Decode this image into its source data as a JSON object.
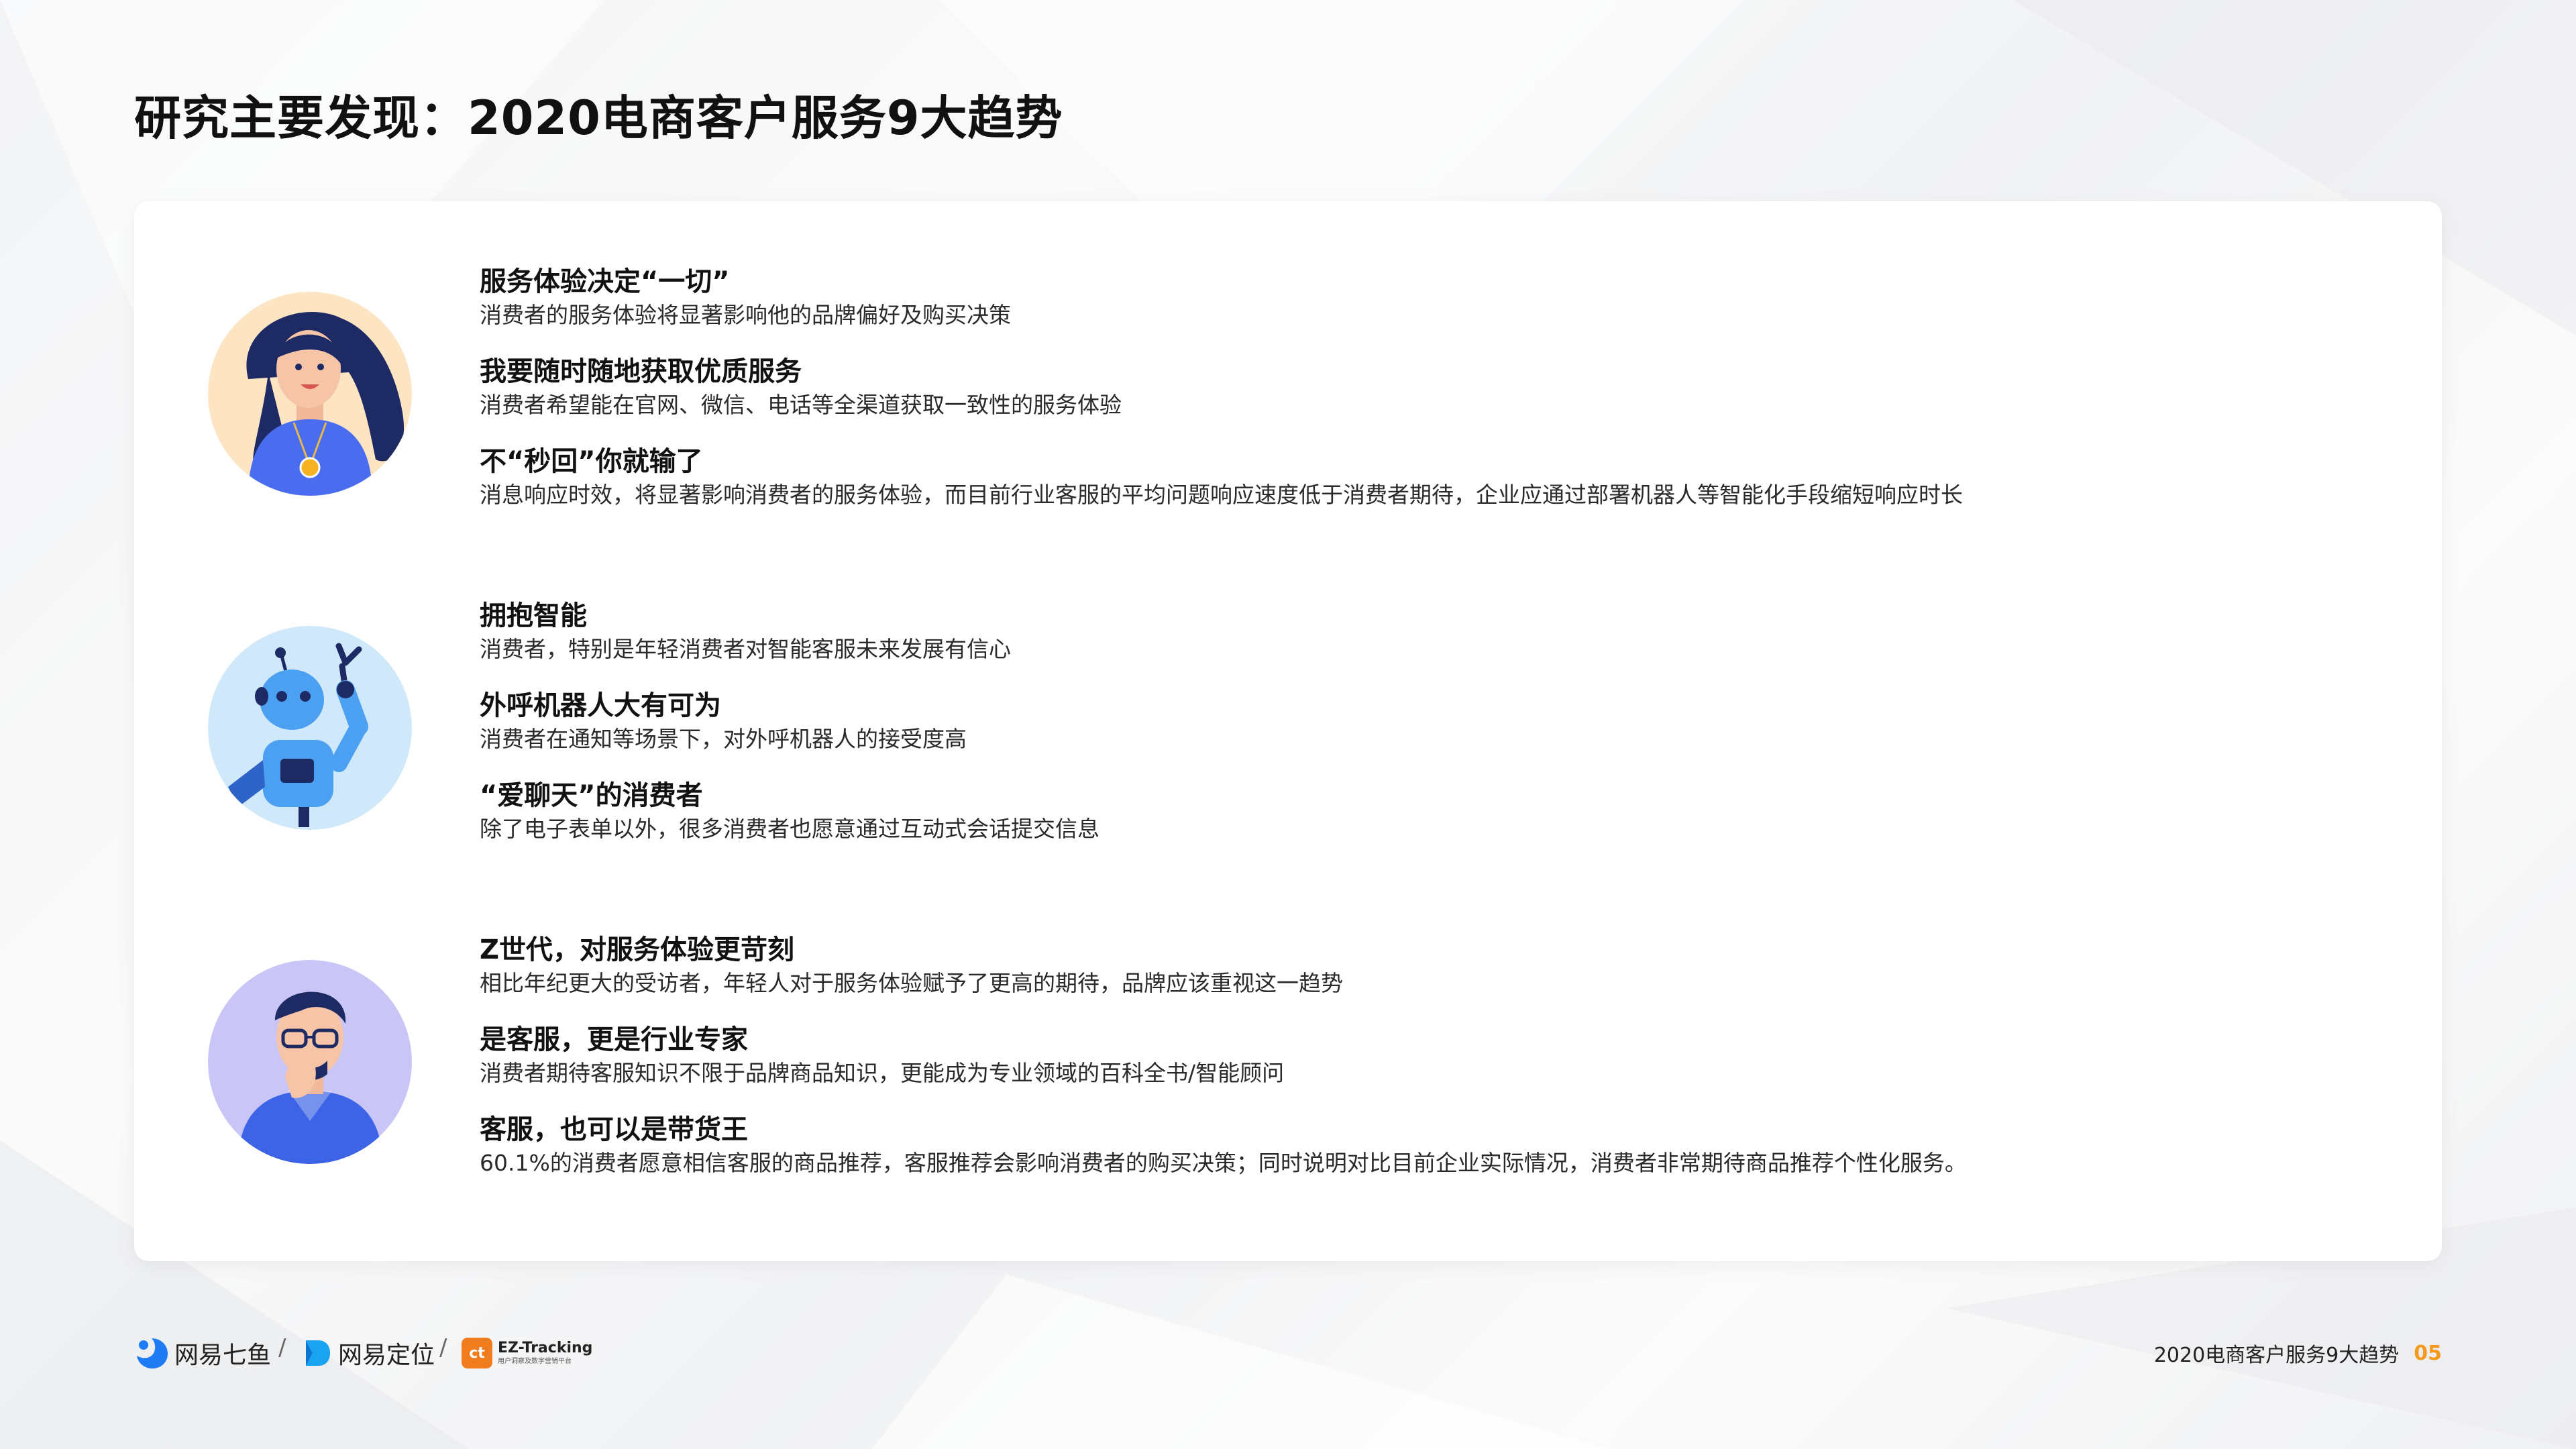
{
  "title": "研究主要发现：2020电商客户服务9大趋势",
  "groups": [
    {
      "avatar": "woman-avatar",
      "items": [
        {
          "title": "服务体验决定“一切”",
          "desc": "消费者的服务体验将显著影响他的品牌偏好及购买决策"
        },
        {
          "title": "我要随时随地获取优质服务",
          "desc": "消费者希望能在官网、微信、电话等全渠道获取一致性的服务体验"
        },
        {
          "title": "不“秒回”你就输了",
          "desc": "消息响应时效，将显著影响消费者的服务体验，而目前行业客服的平均问题响应速度低于消费者期待，企业应通过部署机器人等智能化手段缩短响应时长"
        }
      ]
    },
    {
      "avatar": "robot-avatar",
      "items": [
        {
          "title": "拥抱智能",
          "desc": "消费者，特别是年轻消费者对智能客服未来发展有信心"
        },
        {
          "title": "外呼机器人大有可为",
          "desc": "消费者在通知等场景下，对外呼机器人的接受度高"
        },
        {
          "title": "“爱聊天”的消费者",
          "desc": "除了电子表单以外，很多消费者也愿意通过互动式会话提交信息"
        }
      ]
    },
    {
      "avatar": "man-avatar",
      "items": [
        {
          "title": "Z世代，对服务体验更苛刻",
          "desc": "相比年纪更大的受访者，年轻人对于服务体验赋予了更高的期待，品牌应该重视这一趋势"
        },
        {
          "title": "是客服，更是行业专家",
          "desc": "消费者期待客服知识不限于品牌商品知识，更能成为专业领域的百科全书/智能顾问"
        },
        {
          "title": "客服，也可以是带货王",
          "desc": "60.1%的消费者愿意相信客服的商品推荐，客服推荐会影响消费者的购买决策；同时说明对比目前企业实际情况，消费者非常期待商品推荐个性化服务。"
        }
      ]
    }
  ],
  "footer": {
    "brand1": "网易七鱼",
    "brand2": "网易定位",
    "separator": "/",
    "brand3_main": "EZ-Tracking",
    "brand3_sub": "用户洞察及数字营销平台",
    "brand3_badge": "ct",
    "doc_title": "2020电商客户服务9大趋势",
    "page": "05"
  },
  "colors": {
    "accent_orange": "#f39a1e",
    "qiyu_blue": "#1f7cf5",
    "ding_blue": "#1aa3f0",
    "ez_orange": "#f07c1e"
  }
}
